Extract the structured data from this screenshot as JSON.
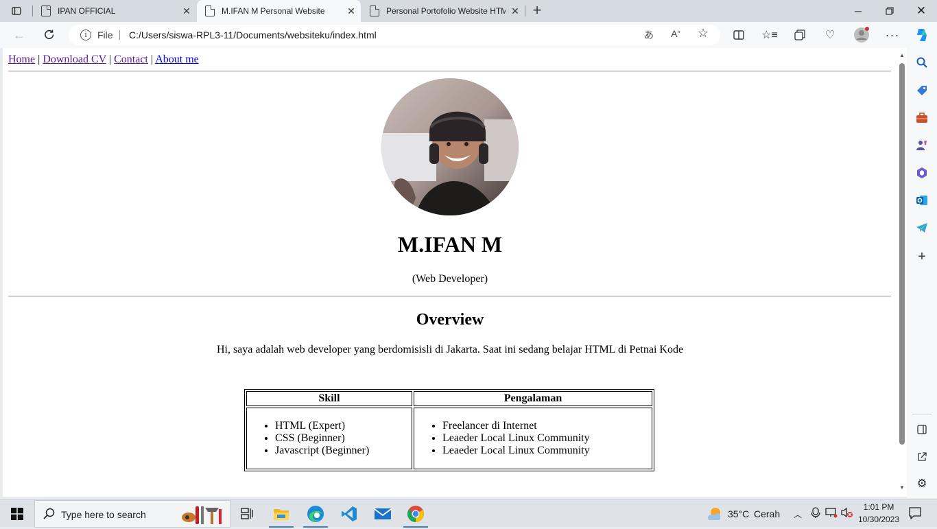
{
  "browser": {
    "tabs": [
      {
        "title": "IPAN OFFICIAL",
        "active": false
      },
      {
        "title": "M.IFAN M Personal Website",
        "active": true
      },
      {
        "title": "Personal Portofolio Website HTML",
        "active": false
      }
    ],
    "address": {
      "scheme_label": "File",
      "url": "C:/Users/siswa-RPL3-11/Documents/websiteku/index.html"
    },
    "icons": [
      "back-icon",
      "refresh-icon",
      "read-aloud-icon",
      "favorite-icon",
      "split-screen-icon",
      "favorites-icon",
      "collections-icon",
      "browser-essentials-icon",
      "profile-icon",
      "more-icon",
      "copilot-icon"
    ]
  },
  "page": {
    "nav": [
      {
        "label": "Home"
      },
      {
        "label": "Download CV"
      },
      {
        "label": "Contact"
      },
      {
        "label": "About me"
      }
    ],
    "nav_separator": "|",
    "name": "M.IFAN M",
    "role": "(Web Developer)",
    "overview_title": "Overview",
    "overview_text": "Hi, saya adalah web developer yang berdomisisli di Jakarta. Saat ini sedang belajar HTML di Petnai Kode",
    "table": {
      "headers": [
        "Skill",
        "Pengalaman"
      ],
      "skills": [
        "HTML (Expert)",
        "CSS (Beginner)",
        "Javascript (Beginner)"
      ],
      "experience": [
        "Freelancer di Internet",
        "Leaeder Local Linux Community",
        "Leaeder Local Linux Community"
      ]
    }
  },
  "sidebar_icons": [
    "search-icon",
    "shopping-icon",
    "tools-icon",
    "games-icon",
    "microsoft-365-icon",
    "outlook-icon",
    "telegram-icon",
    "add-icon",
    "sidebar-toggle-icon",
    "external-link-icon",
    "settings-icon"
  ],
  "taskbar": {
    "search_placeholder": "Type here to search",
    "weather": {
      "temp": "35°C",
      "condition": "Cerah"
    },
    "time": "1:01 PM",
    "date": "10/30/2023"
  },
  "colors": {
    "accent": "#0067c0",
    "visited_link": "#551a8b",
    "link": "#0000ee"
  }
}
